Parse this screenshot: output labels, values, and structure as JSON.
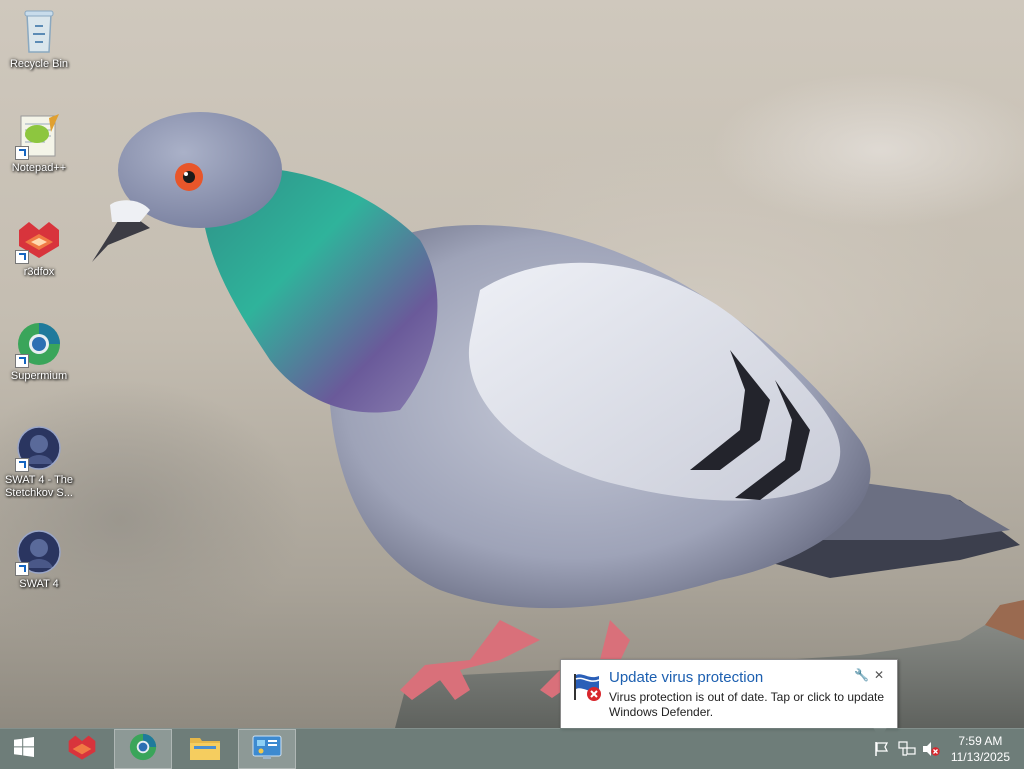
{
  "desktop": {
    "icons": [
      {
        "label": "Recycle Bin",
        "icon": "recycle-bin-icon",
        "shortcut": false
      },
      {
        "label": "Notepad++",
        "icon": "notepad-plus-plus-icon",
        "shortcut": true
      },
      {
        "label": "r3dfox",
        "icon": "r3dfox-icon",
        "shortcut": true
      },
      {
        "label": "Supermium",
        "icon": "supermium-icon",
        "shortcut": true
      },
      {
        "label": "SWAT 4 - The Stetchkov S...",
        "icon": "swat4-stetchkov-icon",
        "shortcut": true
      },
      {
        "label": "SWAT 4",
        "icon": "swat4-icon",
        "shortcut": true
      }
    ]
  },
  "notification": {
    "title": "Update virus protection",
    "body": "Virus protection is out of date. Tap or click to update Windows Defender.",
    "icon": "defender-warning-flag-icon"
  },
  "taskbar": {
    "start_icon": "windows-start-icon",
    "pinned": [
      {
        "name": "r3dfox",
        "icon": "r3dfox-icon",
        "active": false
      },
      {
        "name": "Supermium",
        "icon": "supermium-icon",
        "active": true
      },
      {
        "name": "File Explorer",
        "icon": "file-explorer-icon",
        "active": false
      },
      {
        "name": "Control Panel",
        "icon": "control-panel-icon",
        "active": true
      }
    ],
    "tray": {
      "icons": [
        "action-center-flag-icon",
        "network-icon",
        "volume-muted-icon"
      ],
      "time": "7:59 AM",
      "date": "11/13/2025"
    }
  },
  "colors": {
    "notification_title": "#1c5fb0",
    "taskbar": "#4e605c"
  }
}
